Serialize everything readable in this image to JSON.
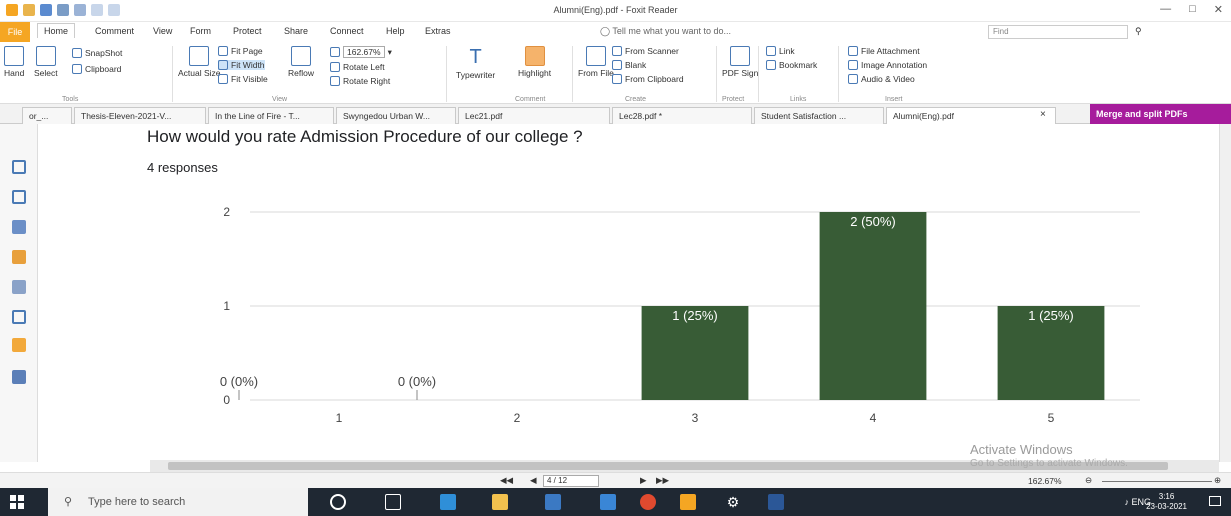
{
  "window": {
    "title": "Alumni(Eng).pdf - Foxit Reader"
  },
  "menu": {
    "file": "File",
    "items": [
      "Home",
      "Comment",
      "View",
      "Form",
      "Protect",
      "Share",
      "Connect",
      "Help",
      "Extras"
    ],
    "tell_me": "Tell me what you want to do...",
    "find_placeholder": "Find"
  },
  "ribbon": {
    "hand": "Hand",
    "select": "Select",
    "snapshot": "SnapShot",
    "clipboard": "Clipboard",
    "actual_size": "Actual Size",
    "fit_page": "Fit Page",
    "fit_width": "Fit Width",
    "fit_visible": "Fit Visible",
    "reflow": "Reflow",
    "zoom": "162.67%",
    "rotate_left": "Rotate Left",
    "rotate_right": "Rotate Right",
    "typewriter": "Typewriter",
    "highlight": "Highlight",
    "from_file": "From File",
    "from_scanner": "From Scanner",
    "blank": "Blank",
    "from_clipboard": "From Clipboard",
    "pdf_sign": "PDF Sign",
    "link": "Link",
    "bookmark": "Bookmark",
    "file_attachment": "File Attachment",
    "image_annotation": "Image Annotation",
    "audio_video": "Audio & Video",
    "groups": [
      "Tools",
      "View",
      "Comment",
      "Create",
      "Protect",
      "Links",
      "Insert"
    ]
  },
  "tabs": [
    {
      "label": "or_..."
    },
    {
      "label": "Thesis-Eleven-2021-V..."
    },
    {
      "label": "In the Line of Fire - T..."
    },
    {
      "label": "Swyngedou Urban W..."
    },
    {
      "label": "Lec21.pdf"
    },
    {
      "label": "Lec28.pdf *"
    },
    {
      "label": "Student Satisfaction ..."
    },
    {
      "label": "Alumni(Eng).pdf"
    }
  ],
  "merge_button": "Merge and split PDFs",
  "document": {
    "question": "How would you rate Admission Procedure of our college ?",
    "responses": "4 responses"
  },
  "chart_data": {
    "type": "bar",
    "categories": [
      "1",
      "2",
      "3",
      "4",
      "5"
    ],
    "values": [
      0,
      0,
      1,
      2,
      1
    ],
    "data_labels": [
      "0 (0%)",
      "0 (0%)",
      "1 (25%)",
      "2 (50%)",
      "1 (25%)"
    ],
    "ylim": [
      0,
      2
    ],
    "yticks": [
      "0",
      "1",
      "2"
    ],
    "color": "#385c36",
    "grid": true,
    "title": "",
    "xlabel": "",
    "ylabel": ""
  },
  "status": {
    "page": "4 / 12",
    "zoom": "162.67%"
  },
  "watermark": {
    "line1": "Activate Windows",
    "line2": "Go to Settings to activate Windows."
  },
  "taskbar": {
    "search": "Type here to search",
    "lang": "ENG",
    "time": "3:16",
    "date": "23-03-2021"
  }
}
